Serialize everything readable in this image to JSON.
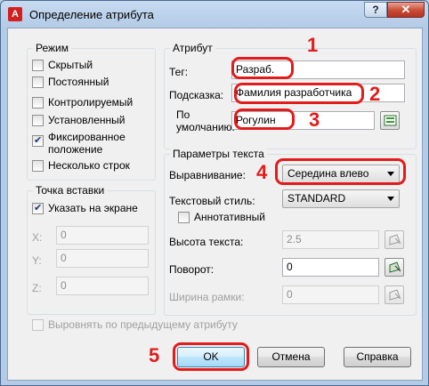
{
  "window": {
    "title": "Определение атрибута",
    "help_label": "?",
    "close_label": "✕"
  },
  "mode": {
    "title": "Режим",
    "options": [
      {
        "label": "Скрытый",
        "checked": false
      },
      {
        "label": "Постоянный",
        "checked": false
      },
      {
        "label": "Контролируемый",
        "checked": false
      },
      {
        "label": "Установленный",
        "checked": false
      },
      {
        "label": "Фиксированное положение",
        "checked": true
      },
      {
        "label": "Несколько строк",
        "checked": false
      }
    ]
  },
  "attribute": {
    "title": "Атрибут",
    "tag_label": "Тег:",
    "tag_value": "Разраб.",
    "prompt_label": "Подсказка:",
    "prompt_value": "Фамилия разработчика",
    "default_label": "По умолчанию:",
    "default_value": "Рогулин"
  },
  "insertion": {
    "title": "Точка вставки",
    "specify_on_screen_label": "Указать на экране",
    "specify_on_screen_checked": true,
    "x_label": "X:",
    "x_value": "0",
    "y_label": "Y:",
    "y_value": "0",
    "z_label": "Z:",
    "z_value": "0"
  },
  "text_settings": {
    "title": "Параметры текста",
    "justification_label": "Выравнивание:",
    "justification_value": "Середина влево",
    "text_style_label": "Текстовый стиль:",
    "text_style_value": "STANDARD",
    "annotative_label": "Аннотативный",
    "annotative_checked": false,
    "text_height_label": "Высота текста:",
    "text_height_value": "2.5",
    "rotation_label": "Поворот:",
    "rotation_value": "0",
    "boundary_width_label": "Ширина рамки:",
    "boundary_width_value": "0"
  },
  "align_previous_label": "Выровнять по предыдущему атрибуту",
  "buttons": {
    "ok": "OK",
    "cancel": "Отмена",
    "help": "Справка"
  },
  "callouts": [
    "1",
    "2",
    "3",
    "4",
    "5"
  ],
  "colors": {
    "callout": "#e41b1b",
    "title_bar": "#b9d1ea",
    "dialog_bg": "#f0f0f0"
  }
}
